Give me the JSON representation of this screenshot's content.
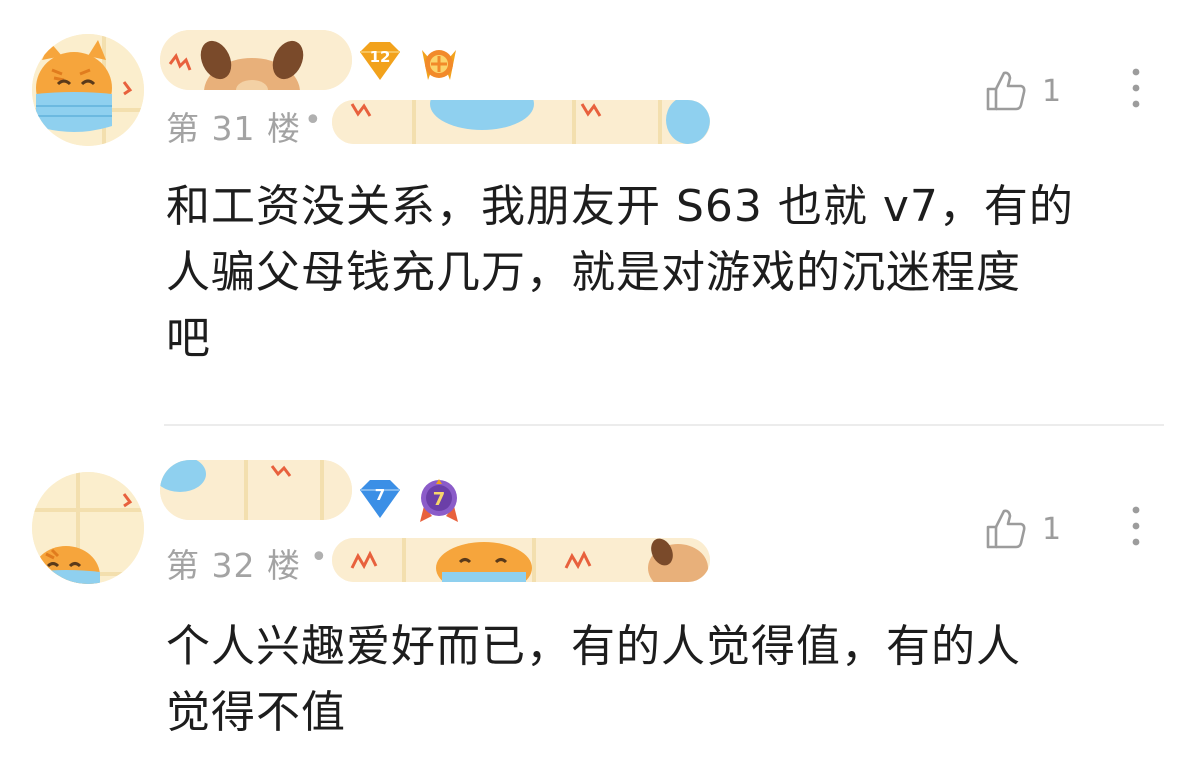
{
  "comments": [
    {
      "floor": "第 31 楼",
      "separator": "•",
      "level": "12",
      "likes": "1",
      "text_lines": [
        "和工资没关系，我朋友开 S63 也就 v7，有的",
        "人骗父母钱充几万，就是对游戏的沉迷程度",
        "吧"
      ]
    },
    {
      "floor": "第 32 楼",
      "separator": "•",
      "level": "7",
      "medal_level": "7",
      "likes": "1",
      "text_lines": [
        "个人兴趣爱好而已，有的人觉得值，有的人",
        "觉得不值"
      ]
    }
  ],
  "icons": {
    "like": "thumbs-up-icon",
    "more": "more-vertical-icon",
    "level_badge": "diamond-level-badge",
    "medal": "medal-icon"
  },
  "colors": {
    "level_badge_gold": "#f2a21c",
    "level_badge_blue": "#3b8fe6",
    "medal_purple": "#8b5cc9",
    "meta_gray": "#a3a3a3",
    "avatar_bg": "#fbeecd",
    "mask_blue": "#8fd0ef",
    "cat_orange": "#f6a53c"
  }
}
